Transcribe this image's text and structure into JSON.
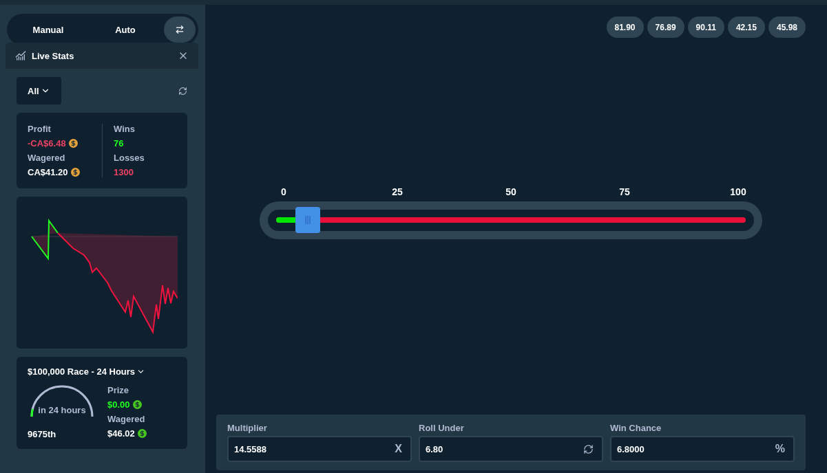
{
  "mode_tabs": [
    {
      "label": "Manual"
    },
    {
      "label": "Auto"
    }
  ],
  "live_stats": {
    "title": "Live Stats",
    "filter": "All",
    "stats": [
      {
        "label": "Profit",
        "value": "-CA$6.48",
        "color": "#ed4163",
        "coin": true
      },
      {
        "label": "Wagered",
        "value": "CA$41.20",
        "color": "#ffffff",
        "coin": true
      },
      {
        "label": "Wins",
        "value": "76",
        "color": "#1fff20",
        "coin": false
      },
      {
        "label": "Losses",
        "value": "1300",
        "color": "#ed4163",
        "coin": false
      }
    ]
  },
  "race": {
    "title": "$100,000 Race - 24 Hours",
    "gauge_text": "in 24 hours",
    "level": 0.08,
    "rank": "9675th",
    "stats": [
      {
        "label": "Prize",
        "value": "$0.00",
        "color": "#1fff20",
        "coin": true
      },
      {
        "label": "Wagered",
        "value": "$46.02",
        "color": "#ffffff",
        "coin": true
      }
    ]
  },
  "recent_results": [
    "81.90",
    "76.89",
    "90.11",
    "42.15",
    "45.98"
  ],
  "slider": {
    "ticks": [
      "0",
      "25",
      "50",
      "75",
      "100"
    ],
    "level": 0.068
  },
  "fields": [
    {
      "label": "Multiplier",
      "value": "14.5588",
      "kind": "suffix",
      "suffix": "X"
    },
    {
      "label": "Roll Under",
      "value": "6.80",
      "kind": "refresh"
    },
    {
      "label": "Win Chance",
      "value": "6.8000",
      "kind": "suffix",
      "suffix": "%"
    }
  ]
}
